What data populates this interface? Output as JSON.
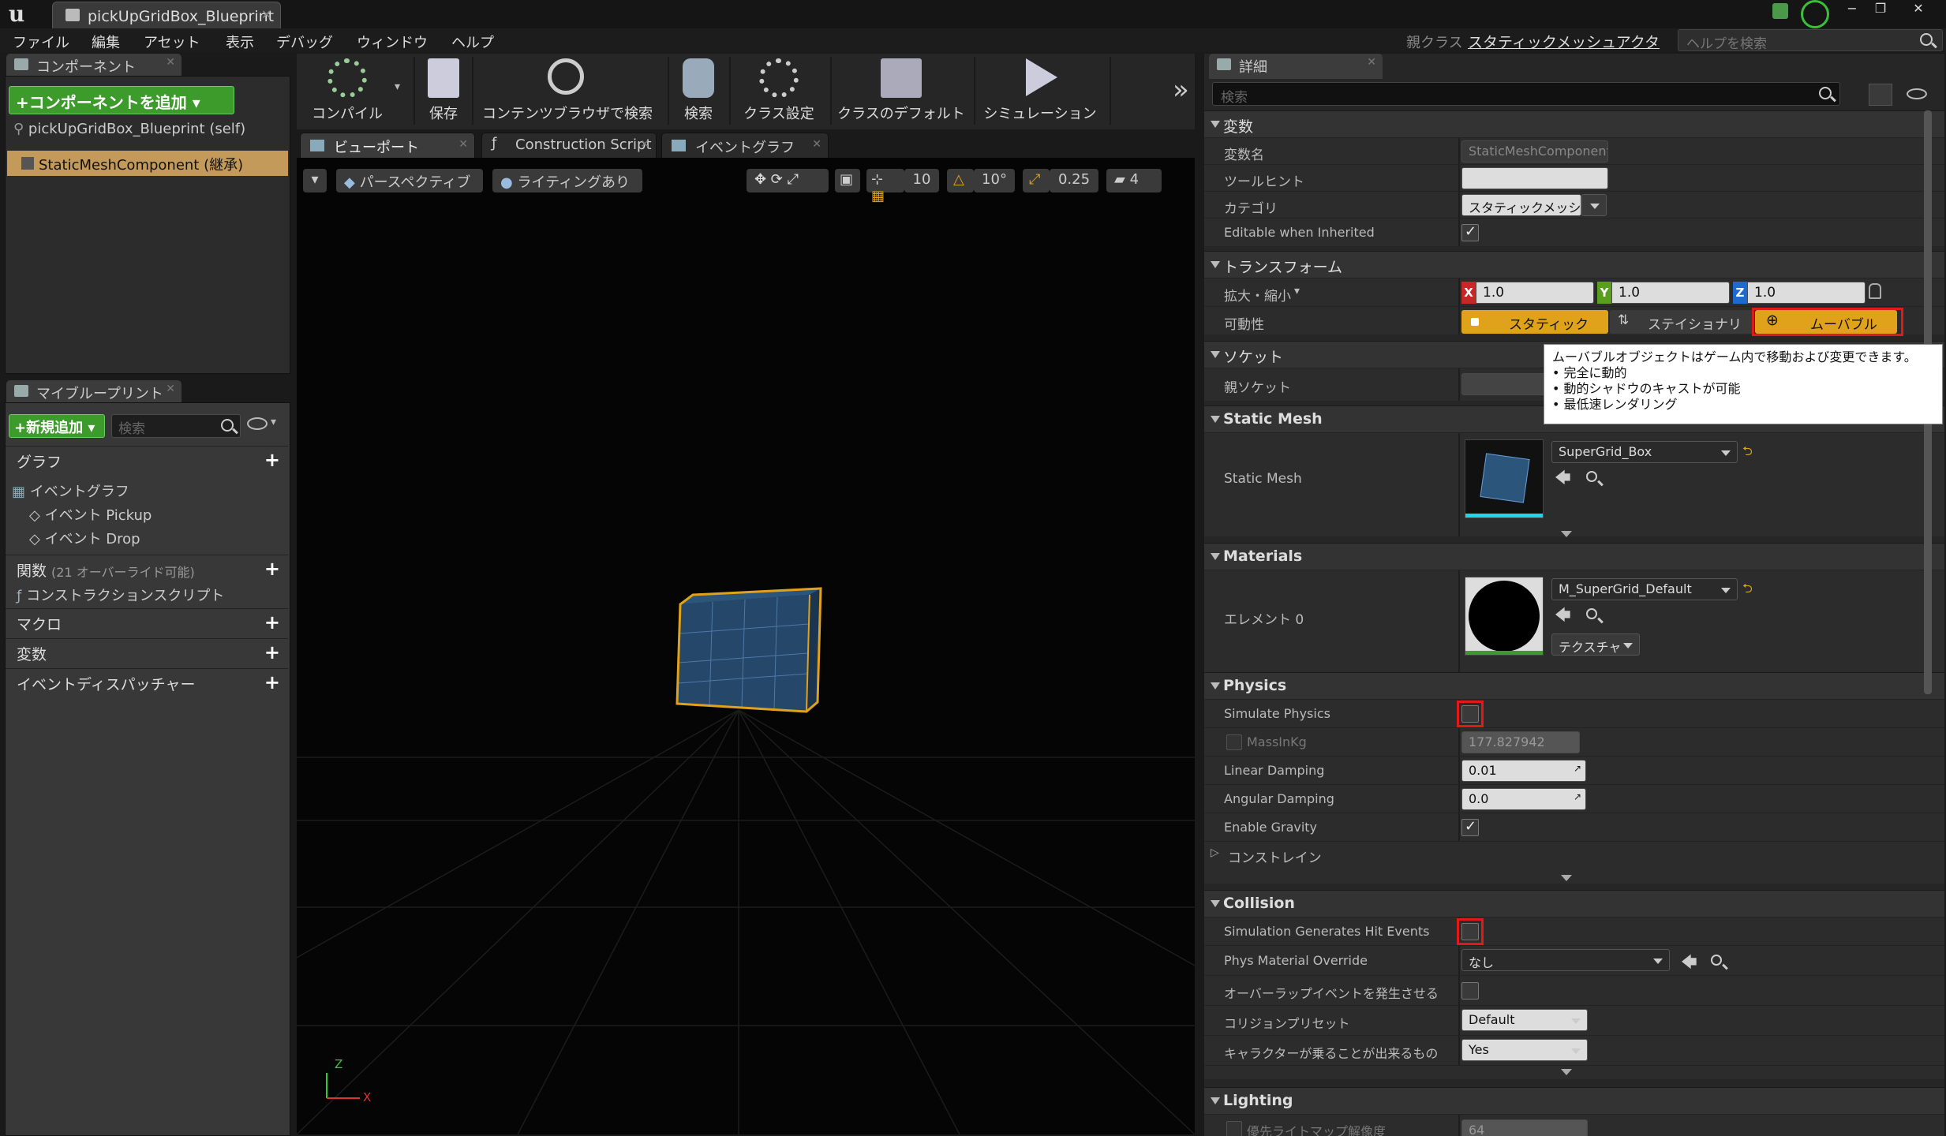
{
  "window": {
    "tab_title": "pickUpGridBox_Blueprint",
    "controls": [
      "−",
      "❐",
      "✕"
    ]
  },
  "menu": [
    "ファイル",
    "編集",
    "アセット",
    "表示",
    "デバッグ",
    "ウィンドウ",
    "ヘルプ"
  ],
  "header": {
    "parent_class_label": "親クラス",
    "parent_class_value": "スタティックメッシュアクタ",
    "help_search_placeholder": "ヘルプを検索"
  },
  "components_panel": {
    "tab": "コンポーネント",
    "add_button": "コンポーネントを追加",
    "items": [
      {
        "label": "pickUpGridBox_Blueprint (self)",
        "selected": false
      },
      {
        "label": "StaticMeshComponent (継承)",
        "selected": true
      }
    ]
  },
  "my_blueprint": {
    "tab": "マイブループリント",
    "new_button": "新規追加",
    "search_placeholder": "検索",
    "graph_section": "グラフ",
    "event_graph": "イベントグラフ",
    "events": [
      "イベント Pickup",
      "イベント Drop"
    ],
    "functions_section": "関数",
    "functions_note": "(21 オーバーライド可能)",
    "construction_script": "コンストラクションスクリプト",
    "macros_section": "マクロ",
    "variables_section": "変数",
    "dispatchers_section": "イベントディスパッチャー"
  },
  "toolbar": {
    "buttons": [
      "コンパイル",
      "保存",
      "コンテンツブラウザで検索",
      "検索",
      "クラス設定",
      "クラスのデフォルト",
      "シミュレーション"
    ],
    "more": "»"
  },
  "editor_tabs": [
    "ビューポート",
    "Construction Script",
    "イベントグラフ"
  ],
  "viewport": {
    "perspective": "パースペクティブ",
    "lighting": "ライティングあり",
    "grid_snap": "10",
    "rotation_snap": "10°",
    "scale_snap": "0.25",
    "camera_speed": "4",
    "axis_z": "Z",
    "axis_x": "X"
  },
  "details": {
    "tab": "詳細",
    "search_placeholder": "検索",
    "variable": {
      "section": "変数",
      "name_label": "変数名",
      "name_value": "StaticMeshComponent",
      "tooltip_label": "ツールヒント",
      "tooltip_value": "",
      "category_label": "カテゴリ",
      "category_value": "スタティックメッシ",
      "editable_label": "Editable when Inherited",
      "editable_checked": true
    },
    "transform": {
      "section": "トランスフォーム",
      "scale_label": "拡大・縮小",
      "x_axis": "X",
      "y_axis": "Y",
      "z_axis": "Z",
      "scale_x": "1.0",
      "scale_y": "1.0",
      "scale_z": "1.0",
      "mobility_label": "可動性",
      "mobility_static": "スタティック",
      "mobility_stationary": "ステイショナリー",
      "mobility_movable": "ムーバブル"
    },
    "tooltip_popup": {
      "line1": "ムーバブルオブジェクトはゲーム内で移動および変更できます。",
      "line2": "• 完全に動的",
      "line3": "• 動的シャドウのキャストが可能",
      "line4": "• 最低速レンダリング"
    },
    "sockets": {
      "section": "ソケット",
      "parent_socket_label": "親ソケット"
    },
    "static_mesh": {
      "section": "Static Mesh",
      "label": "Static Mesh",
      "value": "SuperGrid_Box"
    },
    "materials": {
      "section": "Materials",
      "label": "エレメント 0",
      "value": "M_SuperGrid_Default",
      "texture_button": "テクスチャ"
    },
    "physics": {
      "section": "Physics",
      "simulate_label": "Simulate Physics",
      "simulate_checked": false,
      "mass_label": "MassInKg",
      "mass_value": "177.827942",
      "linear_label": "Linear Damping",
      "linear_value": "0.01",
      "angular_label": "Angular Damping",
      "angular_value": "0.0",
      "gravity_label": "Enable Gravity",
      "gravity_checked": true,
      "constraints_label": "コンストレイン"
    },
    "collision": {
      "section": "Collision",
      "hit_events_label": "Simulation Generates Hit Events",
      "hit_events_checked": false,
      "phys_material_label": "Phys Material Override",
      "phys_material_value": "なし",
      "overlap_label": "オーバーラップイベントを発生させる",
      "overlap_checked": false,
      "preset_label": "コリジョンプリセット",
      "preset_value": "Default",
      "step_up_label": "キャラクターが乗ることが出来るもの",
      "step_up_value": "Yes"
    },
    "lighting": {
      "section": "Lighting",
      "row_label": "優先ライトマップ解像度",
      "row_value": "64"
    }
  },
  "colors": {
    "accent_orange": "#e0a21a",
    "highlight_red": "#e01a1a",
    "add_green": "#3c9b2a"
  }
}
